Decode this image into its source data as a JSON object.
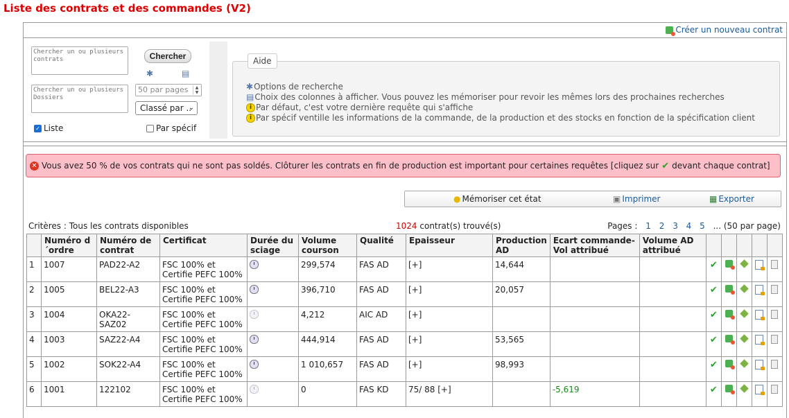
{
  "page": {
    "title": "Liste des contrats et des commandes (V2)"
  },
  "header": {
    "create_label": "Créer un nouveau contrat"
  },
  "search": {
    "contracts_placeholder": "Chercher un ou plusieurs contrats",
    "dossiers_placeholder": "Chercher un ou plusieurs Dossiers",
    "button_label": "Chercher",
    "per_page_placeholder": "50 par pages",
    "sort_select": "Classé par ..",
    "list_label": "Liste",
    "list_checked": true,
    "spec_label": "Par spécif",
    "spec_checked": false
  },
  "aide": {
    "legend": "Aide",
    "lines": [
      "Options de recherche",
      "Choix des colonnes à afficher. Vous pouvez les mémoriser pour revoir les mêmes lors des prochaines recherches",
      "Par défaut, c'est votre dernière requête qui s'affiche",
      "Par spécif ventille les informations de la commande, de la production et des stocks en fonction de la spécification client"
    ]
  },
  "alert": {
    "text_before": "Vous avez 50 % de vos contrats qui ne sont pas soldés. Clôturer les contrats en fin de production est important pour certaines requêtes [cliquez sur",
    "text_after": "devant chaque contrat]"
  },
  "toolbar": {
    "memorize": "Mémoriser cet état",
    "print": "Imprimer",
    "export": "Exporter"
  },
  "results": {
    "criteria": "Critères : Tous les contrats disponibles",
    "count": "1024",
    "count_suffix": "contrat(s) trouvé(s)",
    "pages_label": "Pages :",
    "pages": [
      "1",
      "2",
      "3",
      "4",
      "5"
    ],
    "pages_more": "... (50 par page)"
  },
  "table": {
    "headers": [
      "",
      "Numéro d´ordre",
      "Numéro de contrat",
      "Certificat",
      "Durée du sciage",
      "Volume courson",
      "Qualité",
      "Epaisseur",
      "Production AD",
      "Ecart commande-Vol attribué",
      "Volume AD attribué"
    ],
    "rows": [
      {
        "idx": "1",
        "ordre": "1007",
        "contrat": "PAD22-A2",
        "cert": "FSC 100% et Certifie PEFC 100%",
        "volume": "299,574",
        "qualite": "FAS AD",
        "epaisseur": "[+]",
        "production": "14,644",
        "ecart": "",
        "vol_ad": ""
      },
      {
        "idx": "2",
        "ordre": "1005",
        "contrat": "BEL22-A3",
        "cert": "FSC 100% et Certifie PEFC 100%",
        "volume": "396,710",
        "qualite": "FAS AD",
        "epaisseur": "[+]",
        "production": "20,057",
        "ecart": "",
        "vol_ad": ""
      },
      {
        "idx": "3",
        "ordre": "1004",
        "contrat": "OKA22-SAZ02",
        "cert": "FSC 100% et Certifie PEFC 100%",
        "volume": "4,212",
        "qualite": "AIC AD",
        "epaisseur": "[+]",
        "production": "",
        "ecart": "",
        "vol_ad": ""
      },
      {
        "idx": "4",
        "ordre": "1003",
        "contrat": "SAZ22-A4",
        "cert": "FSC 100% et Certifie PEFC 100%",
        "volume": "444,914",
        "qualite": "FAS AD",
        "epaisseur": "[+]",
        "production": "53,565",
        "ecart": "",
        "vol_ad": ""
      },
      {
        "idx": "5",
        "ordre": "1002",
        "contrat": "SOK22-A4",
        "cert": "FSC 100% et Certifie PEFC 100%",
        "volume": "1 010,657",
        "qualite": "FAS AD",
        "epaisseur": "[+]",
        "production": "98,993",
        "ecart": "",
        "vol_ad": ""
      },
      {
        "idx": "6",
        "ordre": "1001",
        "contrat": "122102",
        "cert": "FSC 100% et Certifie PEFC 100%",
        "volume": "0",
        "qualite": "FAS KD",
        "epaisseur": "75/ 88  [+]",
        "production": "",
        "ecart": "-5,619",
        "vol_ad": ""
      }
    ]
  }
}
